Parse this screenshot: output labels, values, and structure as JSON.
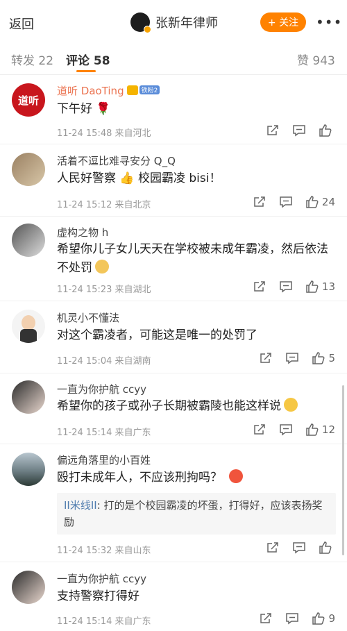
{
  "header": {
    "back_label": "返回",
    "title": "张新年律师",
    "follow_label": "+ 关注",
    "more_label": "•••"
  },
  "tabs": {
    "repost": "转发 22",
    "comments": "评论 58",
    "likes": "赞 943"
  },
  "comments": [
    {
      "name": "道听 DaoTing",
      "fan_badge": "铁粉2",
      "avatar_text": "道听",
      "text": "下午好 🌹",
      "meta": "11-24 15:48  来自河北",
      "likes": ""
    },
    {
      "name": "活着不逗比难寻安分 Q_Q",
      "text": "人民好警察 👍 校园霸凌 bisi！",
      "meta": "11-24 15:12  来自北京",
      "likes": "24"
    },
    {
      "name": "虚构之物 h",
      "text": "希望你儿子女儿天天在学校被未成年霸凌，然后依法不处罚",
      "meta": "11-24 15:23  来自湖北",
      "likes": "13"
    },
    {
      "name": "机灵小不懂法",
      "text": "对这个霸凌者，可能这是唯一的处罚了",
      "meta": "11-24 15:04  来自湖南",
      "likes": "5"
    },
    {
      "name": "一直为你护航 ccyy",
      "text": "希望你的孩子或孙子长期被霸陵也能这样说",
      "meta": "11-24 15:14  来自广东",
      "likes": "12"
    },
    {
      "name": "偏远角落里的小百姓",
      "text": "殴打未成年人，不应该刑拘吗？",
      "meta": "11-24 15:32  来自山东",
      "likes": "",
      "reply_name": "II米线II",
      "reply_text": "打的是个校园霸凌的坏蛋，打得好，应该表扬奖励"
    },
    {
      "name": "一直为你护航 ccyy",
      "text": "支持警察打得好",
      "meta": "11-24 15:14  来自广东",
      "likes": "9"
    }
  ],
  "colors": {
    "accent": "#ff8200",
    "link": "#507daf"
  }
}
